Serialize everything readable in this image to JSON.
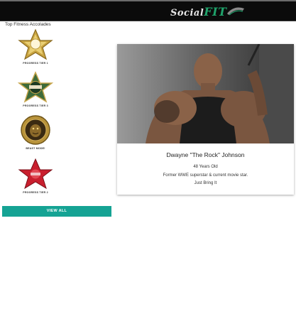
{
  "app": {
    "logo_social": "Social",
    "logo_fit": "FIT"
  },
  "accolades": {
    "title": "Top Fitness Accolades",
    "items": [
      {
        "label": "PROGRESS TIER 1",
        "icon": "gold-star-badge-icon"
      },
      {
        "label": "PROGRESS TIER 3",
        "icon": "green-star-badge-icon"
      },
      {
        "label": "BEAST MODE!",
        "icon": "beast-medallion-icon"
      },
      {
        "label": "PROGRESS TIER 2",
        "icon": "red-star-badge-icon"
      }
    ],
    "view_all_label": "VIEW ALL"
  },
  "profile": {
    "name": "Dwayne \"The Rock\" Johnson",
    "age": "48 Years Old",
    "bio": "Former WWE superstar & current movie star.",
    "tagline": "Just Bring It"
  },
  "colors": {
    "header_bg": "#0b0b0b",
    "accent": "#15a394",
    "logo_green": "#1fa36b"
  }
}
